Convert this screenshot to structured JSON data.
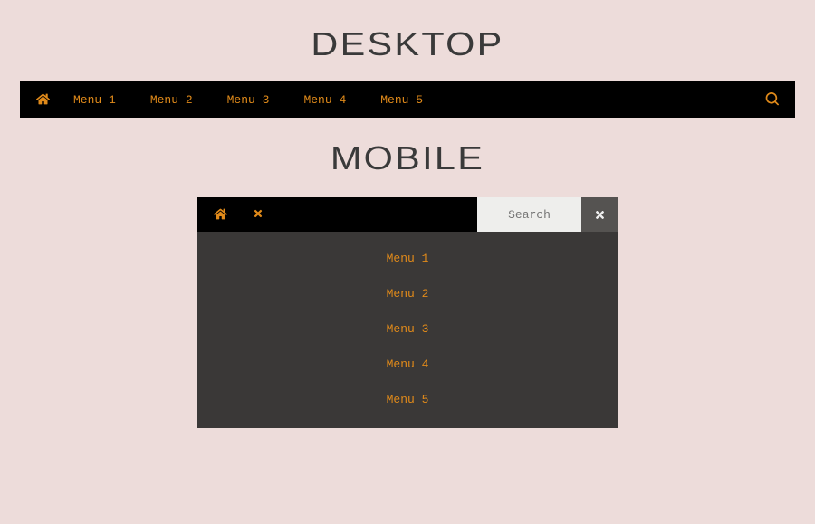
{
  "headings": {
    "desktop": "DESKTOP",
    "mobile": "MOBILE"
  },
  "desktopNav": {
    "menuItems": [
      "Menu 1",
      "Menu 2",
      "Menu 3",
      "Menu 4",
      "Menu 5"
    ]
  },
  "mobileNav": {
    "searchPlaceholder": "Search",
    "menuItems": [
      "Menu 1",
      "Menu 2",
      "Menu 3",
      "Menu 4",
      "Menu 5"
    ]
  },
  "colors": {
    "accent": "#e08a1a",
    "background": "#eddcda",
    "navBar": "#000000",
    "mobilePanel": "#3a3837"
  }
}
